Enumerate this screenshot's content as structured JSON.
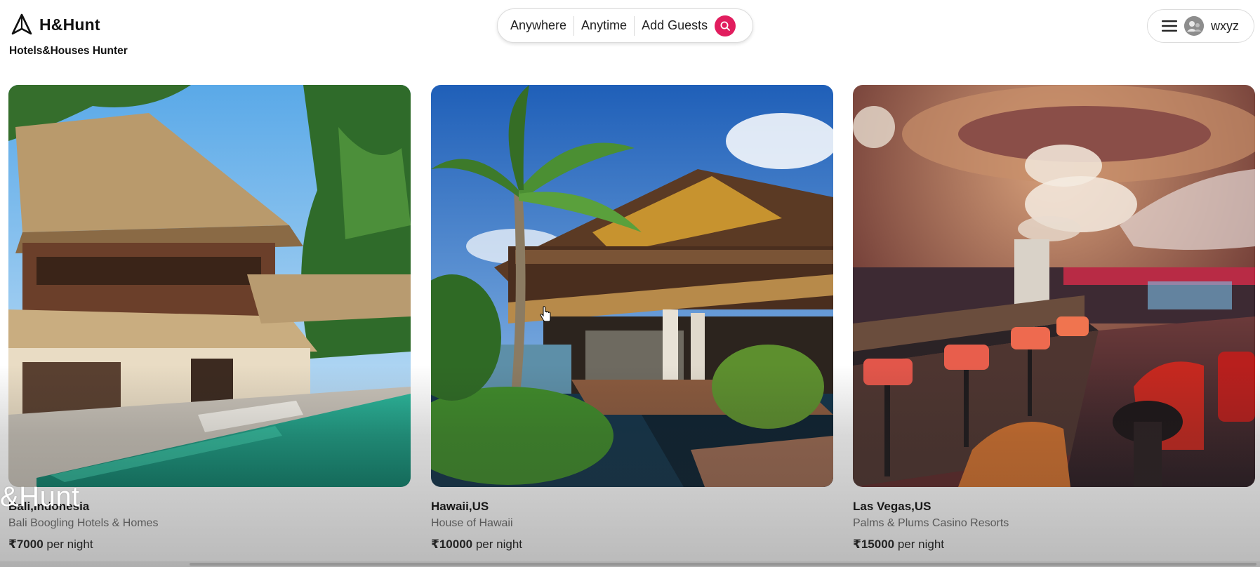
{
  "header": {
    "logo_text": "H&Hunt",
    "tagline": "Hotels&Houses Hunter"
  },
  "search": {
    "anywhere": "Anywhere",
    "anytime": "Anytime",
    "add_guests": "Add Guests",
    "icon": "search-icon",
    "accent_color": "#e11d5e"
  },
  "user_menu": {
    "menu_icon": "hamburger-icon",
    "avatar_icon": "user-avatar-icon",
    "username": "wxyz"
  },
  "listings": [
    {
      "location": "Bali,Indonesia",
      "name": "Bali Boogling Hotels & Homes",
      "price": "₹7000",
      "price_suffix": "per night"
    },
    {
      "location": "Hawaii,US",
      "name": "House of Hawaii",
      "price": "₹10000",
      "price_suffix": "per night"
    },
    {
      "location": "Las Vegas,US",
      "name": "Palms & Plums Casino Resorts",
      "price": "₹15000",
      "price_suffix": "per night"
    }
  ],
  "overlay": {
    "brand_text": "&Hunt"
  }
}
